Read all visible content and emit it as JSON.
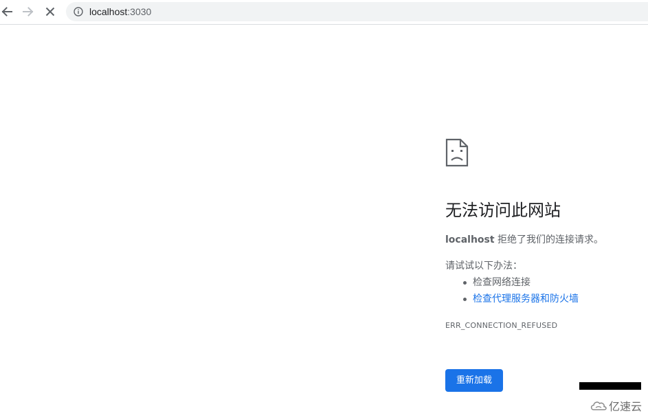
{
  "toolbar": {
    "url_host": "localhost",
    "url_port": ":3030"
  },
  "icons": {
    "back": "back-arrow-icon",
    "forward": "forward-arrow-icon",
    "stop": "close-icon",
    "site_info": "info-icon",
    "error_page": "sad-page-icon"
  },
  "error": {
    "title": "无法访问此网站",
    "host": "localhost",
    "message": " 拒绝了我们的连接请求。",
    "suggestions_heading": "请试试以下办法：",
    "suggestions": [
      "检查网络连接",
      "检查代理服务器和防火墙"
    ],
    "code": "ERR_CONNECTION_REFUSED",
    "reload_label": "重新加载"
  },
  "watermark": {
    "text": "亿速云"
  },
  "colors": {
    "accent": "#1a73e8",
    "body_text": "#5f6368",
    "title_text": "#202124",
    "omnibox_bg": "#f1f3f4"
  }
}
